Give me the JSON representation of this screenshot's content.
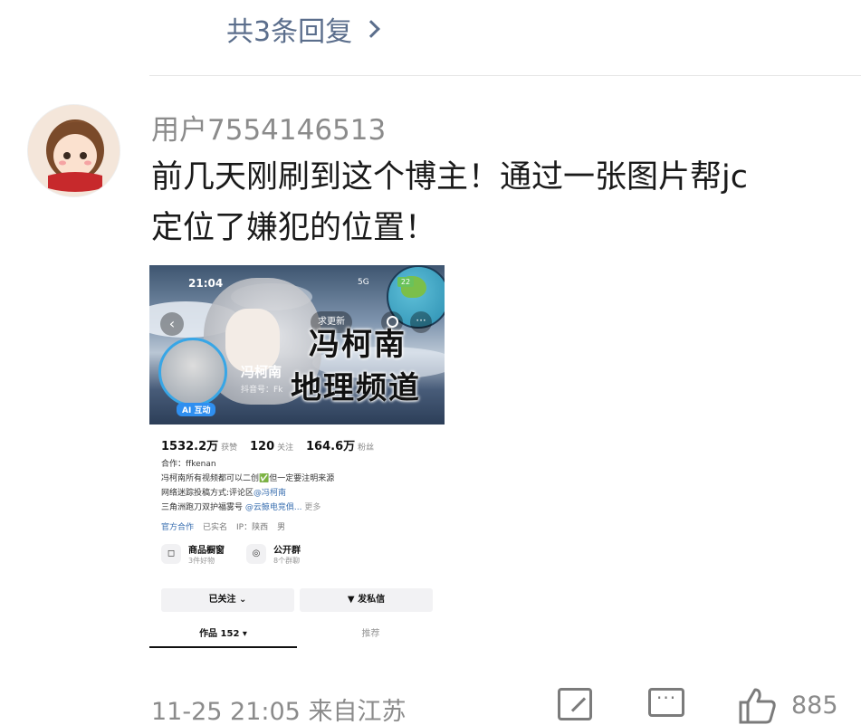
{
  "replies_link": {
    "label": "共3条回复"
  },
  "comment": {
    "username": "用户7554146513",
    "text_line1": "前几天刚刷到这个博主！通过一张图片帮jc",
    "text_line2": "定位了嫌犯的位置！",
    "timestamp": "11-25 21:05",
    "location": "来自江苏",
    "likes": "885"
  },
  "embedded_screenshot": {
    "status_time": "21:04",
    "status_signal": "5G",
    "status_battery": "22",
    "qiu_gengxin": "求更新",
    "banner_title_line1": "冯柯南",
    "banner_title_line2": "地理频道",
    "profile_name": "冯柯南",
    "ai_badge": "AI 互动",
    "id_line": "抖音号：Fk",
    "stats": [
      {
        "value": "1532.2万",
        "label": "获赞"
      },
      {
        "value": "120",
        "label": "关注"
      },
      {
        "value": "164.6万",
        "label": "粉丝"
      }
    ],
    "bio": {
      "line1": "合作：ffkenan",
      "line2_a": "冯柯南所有视频都可以二创",
      "line2_b": "✅",
      "line2_c": "但一定要注明来源",
      "line3_a": "网络迷踪投稿方式:评论区",
      "line3_link": "@冯柯南",
      "line4_a": "三角洲跑刀双护福雾号",
      "line4_link": "@云鲸电竞俱...",
      "line4_more": "更多"
    },
    "tags": [
      "官方合作",
      "已实名",
      "IP：陕西",
      "男"
    ],
    "cards": [
      {
        "title": "商品橱窗",
        "sub": "3件好物"
      },
      {
        "title": "公开群",
        "sub": "8个群聊"
      }
    ],
    "followed_button": "已关注",
    "message_button": "发私信",
    "tabs": [
      {
        "label": "作品 152 ▾"
      },
      {
        "label": "推荐"
      }
    ]
  },
  "icons": {
    "share": "share-icon",
    "comment": "comment-icon",
    "like": "thumbs-up-icon"
  }
}
